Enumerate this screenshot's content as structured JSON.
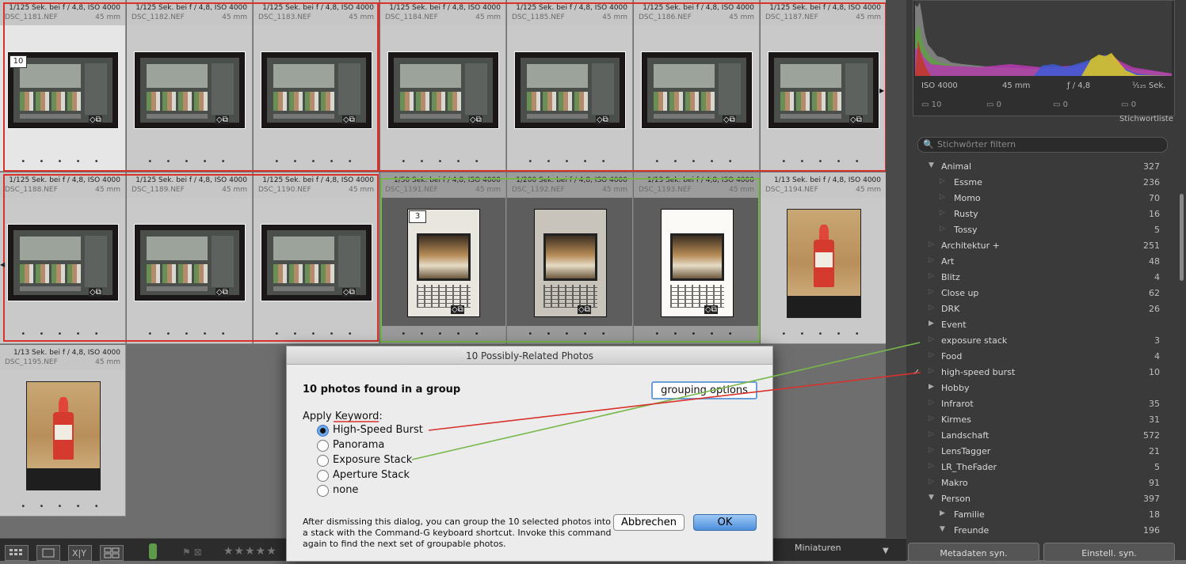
{
  "grid": {
    "cells": [
      {
        "exposure": "1/125 Sek. bei f / 4,8, ISO 4000",
        "file": "DSC_1181.NEF",
        "focal": "45 mm",
        "badge": "10",
        "dots": "• • • • •"
      },
      {
        "exposure": "1/125 Sek. bei f / 4,8, ISO 4000",
        "file": "DSC_1182.NEF",
        "focal": "45 mm",
        "dots": "• • • • •"
      },
      {
        "exposure": "1/125 Sek. bei f / 4,8, ISO 4000",
        "file": "DSC_1183.NEF",
        "focal": "45 mm",
        "dots": "• • • • •"
      },
      {
        "exposure": "1/125 Sek. bei f / 4,8, ISO 4000",
        "file": "DSC_1184.NEF",
        "focal": "45 mm",
        "dots": "• • • • •"
      },
      {
        "exposure": "1/125 Sek. bei f / 4,8, ISO 4000",
        "file": "DSC_1185.NEF",
        "focal": "45 mm",
        "dots": "• • • • •"
      },
      {
        "exposure": "1/125 Sek. bei f / 4,8, ISO 4000",
        "file": "DSC_1186.NEF",
        "focal": "45 mm",
        "dots": "• • • • •"
      },
      {
        "exposure": "1/125 Sek. bei f / 4,8, ISO 4000",
        "file": "DSC_1187.NEF",
        "focal": "45 mm",
        "dots": "• • • • •"
      },
      {
        "exposure": "1/125 Sek. bei f / 4,8, ISO 4000",
        "file": "DSC_1188.NEF",
        "focal": "45 mm",
        "dots": "• • • • •"
      },
      {
        "exposure": "1/125 Sek. bei f / 4,8, ISO 4000",
        "file": "DSC_1189.NEF",
        "focal": "45 mm",
        "dots": "• • • • •"
      },
      {
        "exposure": "1/125 Sek. bei f / 4,8, ISO 4000",
        "file": "DSC_1190.NEF",
        "focal": "45 mm",
        "dots": "• • • • •"
      },
      {
        "exposure": "1/50 Sek. bei f / 4,8, ISO 4000",
        "file": "DSC_1191.NEF",
        "focal": "45 mm",
        "badge": "3",
        "dots": "• • • • •"
      },
      {
        "exposure": "1/200 Sek. bei f / 4,8, ISO 4000",
        "file": "DSC_1192.NEF",
        "focal": "45 mm",
        "dots": "• • • • •"
      },
      {
        "exposure": "1/13 Sek. bei f / 4,8, ISO 4000",
        "file": "DSC_1193.NEF",
        "focal": "45 mm",
        "dots": "• • • • •"
      },
      {
        "exposure": "1/13 Sek. bei f / 4,8, ISO 4000",
        "file": "DSC_1194.NEF",
        "focal": "45 mm",
        "dots": "• • • • •"
      },
      {
        "exposure": "1/13 Sek. bei f / 4,8, ISO 4000",
        "file": "DSC_1195.NEF",
        "focal": "45 mm",
        "dots": "• • • • •"
      }
    ],
    "thumb_icons": "◇⧉"
  },
  "histogram": {
    "iso": "ISO 4000",
    "focal": "45 mm",
    "aperture": "ƒ / 4,8",
    "shutter": "¹⁄₁₂₅ Sek.",
    "counts": [
      "10",
      "0",
      "0",
      "0"
    ]
  },
  "keywords": {
    "header": "Stichwortliste",
    "filter_placeholder": "Stichwörter filtern",
    "items": [
      {
        "name": "Animal",
        "count": "327",
        "level": 0,
        "tri": "▼"
      },
      {
        "name": "Essme",
        "count": "236",
        "level": 1,
        "tri": "▷"
      },
      {
        "name": "Momo",
        "count": "70",
        "level": 1,
        "tri": "▷"
      },
      {
        "name": "Rusty",
        "count": "16",
        "level": 1,
        "tri": "▷"
      },
      {
        "name": "Tossy",
        "count": "5",
        "level": 1,
        "tri": "▷"
      },
      {
        "name": "Architektur  +",
        "count": "251",
        "level": 0,
        "tri": "▷"
      },
      {
        "name": "Art",
        "count": "48",
        "level": 0,
        "tri": "▷"
      },
      {
        "name": "Blitz",
        "count": "4",
        "level": 0,
        "tri": "▷"
      },
      {
        "name": "Close up",
        "count": "62",
        "level": 0,
        "tri": "▷"
      },
      {
        "name": "DRK",
        "count": "26",
        "level": 0,
        "tri": "▷"
      },
      {
        "name": "Event",
        "count": "",
        "level": 0,
        "tri": "▶"
      },
      {
        "name": "exposure stack",
        "count": "3",
        "level": 0,
        "tri": "▷"
      },
      {
        "name": "Food",
        "count": "4",
        "level": 0,
        "tri": "▷"
      },
      {
        "name": "high-speed burst",
        "count": "10",
        "level": 0,
        "tri": "▷",
        "check": "✓"
      },
      {
        "name": "Hobby",
        "count": "",
        "level": 0,
        "tri": "▶"
      },
      {
        "name": "Infrarot",
        "count": "35",
        "level": 0,
        "tri": "▷"
      },
      {
        "name": "Kirmes",
        "count": "31",
        "level": 0,
        "tri": "▷"
      },
      {
        "name": "Landschaft",
        "count": "572",
        "level": 0,
        "tri": "▷"
      },
      {
        "name": "LensTagger",
        "count": "21",
        "level": 0,
        "tri": "▷"
      },
      {
        "name": "LR_TheFader",
        "count": "5",
        "level": 0,
        "tri": "▷"
      },
      {
        "name": "Makro",
        "count": "91",
        "level": 0,
        "tri": "▷"
      },
      {
        "name": "Person",
        "count": "397",
        "level": 0,
        "tri": "▼"
      },
      {
        "name": "Familie",
        "count": "18",
        "level": 1,
        "tri": "▶"
      },
      {
        "name": "Freunde",
        "count": "196",
        "level": 1,
        "tri": "▼"
      }
    ]
  },
  "bottom": {
    "miniaturen": "Miniaturen",
    "metadata_sync": "Metadaten syn.",
    "settings_sync": "Einstell. syn."
  },
  "dialog": {
    "title": "10 Possibly-Related Photos",
    "headline": "10 photos found in a group",
    "grouping_button": "grouping options",
    "apply_label": "Apply Keyword:",
    "options": [
      "High-Speed Burst",
      "Panorama",
      "Exposure Stack",
      "Aperture Stack",
      "none"
    ],
    "selected": "High-Speed Burst",
    "note": "After dismissing this dialog, you can group the 10 selected photos into a stack with the Command-G keyboard shortcut. Invoke this command again to find the next set of groupable photos.",
    "cancel": "Abbrechen",
    "ok": "OK"
  },
  "colors": {
    "red_annotation": "#d8322d",
    "green_annotation": "#78b84a",
    "ok_blue": "#4d8fdc"
  }
}
